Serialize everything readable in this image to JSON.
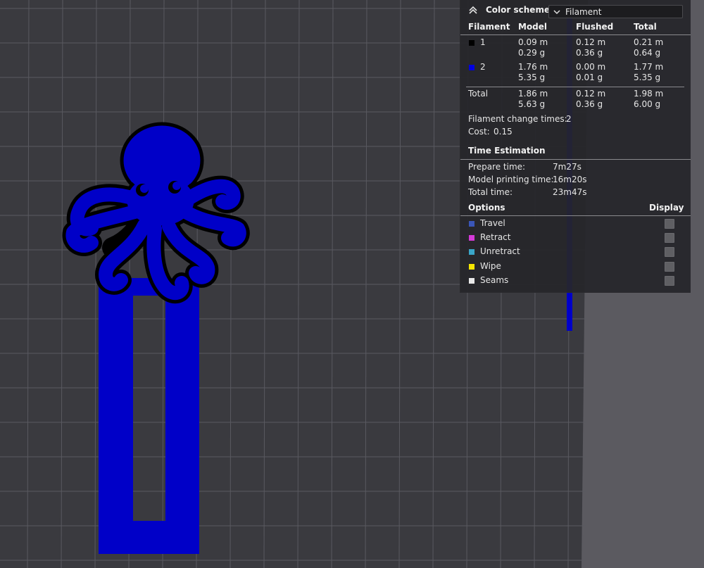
{
  "legend": {
    "color_scheme_label": "Color scheme",
    "color_scheme_value": "Filament",
    "table": {
      "headers": [
        "Filament",
        "Model",
        "Flushed",
        "Total"
      ],
      "rows": [
        {
          "id": "1",
          "color": "#000000",
          "model_m": "0.09 m",
          "model_g": "0.29 g",
          "flushed_m": "0.12 m",
          "flushed_g": "0.36 g",
          "total_m": "0.21 m",
          "total_g": "0.64 g"
        },
        {
          "id": "2",
          "color": "#0000e0",
          "model_m": "1.76 m",
          "model_g": "5.35 g",
          "flushed_m": "0.00 m",
          "flushed_g": "0.01 g",
          "total_m": "1.77 m",
          "total_g": "5.35 g"
        }
      ],
      "total": {
        "label": "Total",
        "model_m": "1.86 m",
        "model_g": "5.63 g",
        "flushed_m": "0.12 m",
        "flushed_g": "0.36 g",
        "total_m": "1.98 m",
        "total_g": "6.00 g"
      }
    },
    "filament_change": {
      "label": "Filament change times:",
      "value": "2"
    },
    "cost": {
      "label": "Cost:",
      "value": "0.15"
    },
    "time_estimation": {
      "title": "Time Estimation",
      "prepare": {
        "label": "Prepare time:",
        "value": "7m27s"
      },
      "model": {
        "label": "Model printing time:",
        "value": "16m20s"
      },
      "total": {
        "label": "Total time:",
        "value": "23m47s"
      }
    },
    "options": {
      "title": "Options",
      "display_label": "Display",
      "items": [
        {
          "label": "Travel",
          "color": "#3a56b8"
        },
        {
          "label": "Retract",
          "color": "#d43ad8"
        },
        {
          "label": "Unretract",
          "color": "#3aa6c8"
        },
        {
          "label": "Wipe",
          "color": "#f5e600"
        },
        {
          "label": "Seams",
          "color": "#e8e8e8"
        }
      ]
    }
  },
  "colors": {
    "plate": "#3a3a3f",
    "grid_line": "#5a5a60",
    "model_blue": "#0000c8",
    "outline_black": "#000000"
  }
}
